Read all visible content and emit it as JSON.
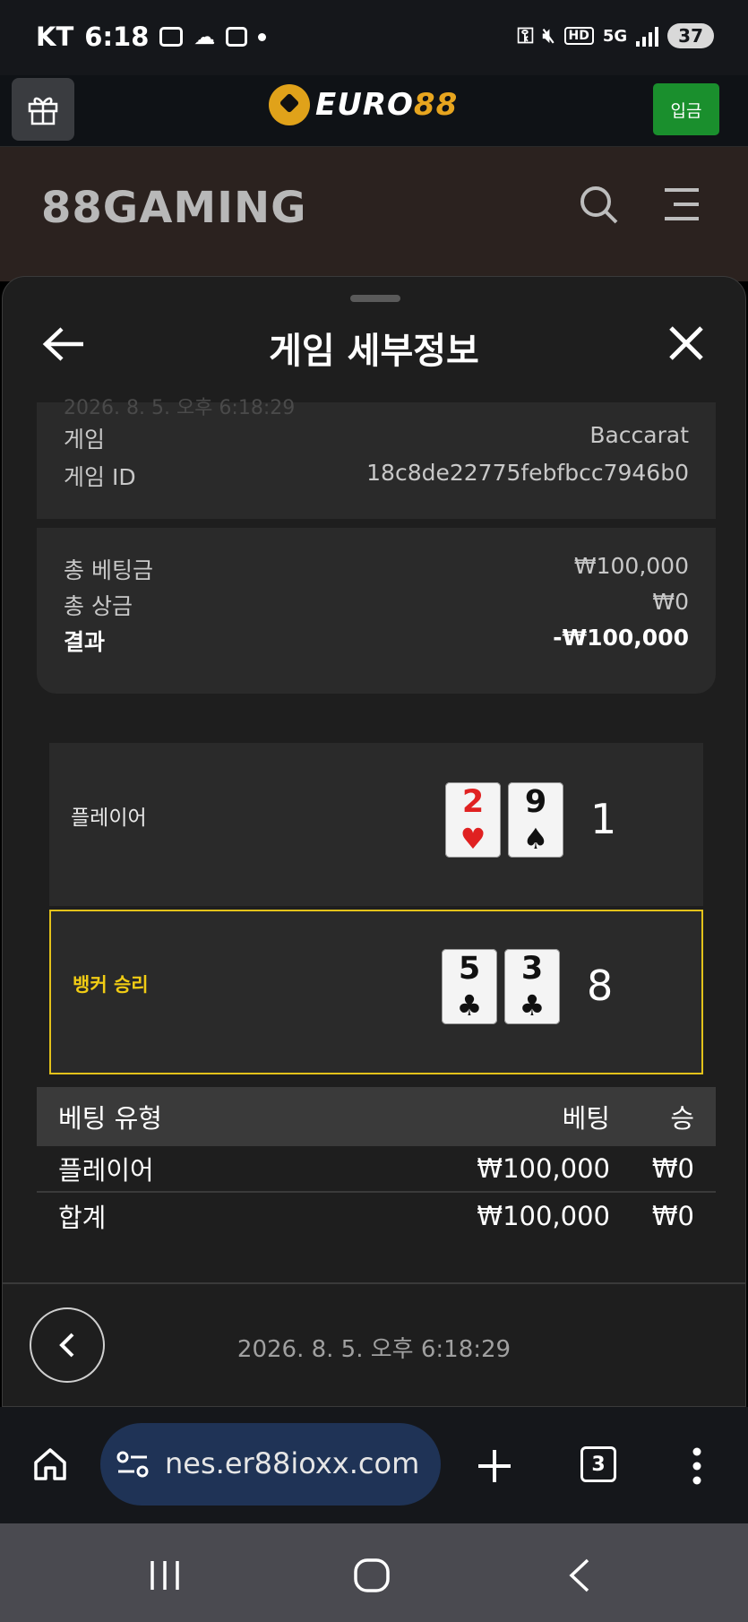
{
  "status_bar": {
    "carrier": "KT",
    "time": "6:18",
    "network": "5G",
    "hd": "HD",
    "battery": "37"
  },
  "site_header": {
    "logo_prefix": "EURO",
    "logo_suffix": "88",
    "deposit_label": "입금",
    "brand_color": "#e7a51f",
    "deposit_color": "#1a8f2d"
  },
  "gaming_header": {
    "logo": "88GAMING"
  },
  "sheet": {
    "title": "게임 세부정보",
    "cutoff_text": "2026. 8. 5. 오후 6:18:29",
    "game_label": "게임",
    "game_value": "Baccarat",
    "game_id_label": "게임 ID",
    "game_id_value": "18c8de22775febfbcc7946b0",
    "total_bet_label": "총 베팅금",
    "total_bet_value": "₩100,000",
    "total_prize_label": "총 상금",
    "total_prize_value": "₩0",
    "result_label": "결과",
    "result_value": "-₩100,000"
  },
  "hands": {
    "player": {
      "label": "플레이어",
      "cards": [
        {
          "rank": "2",
          "suit": "♥",
          "color": "red"
        },
        {
          "rank": "9",
          "suit": "♠",
          "color": "black"
        }
      ],
      "score": "1"
    },
    "banker": {
      "label": "뱅커 승리",
      "cards": [
        {
          "rank": "5",
          "suit": "♣",
          "color": "black"
        },
        {
          "rank": "3",
          "suit": "♣",
          "color": "black"
        }
      ],
      "score": "8",
      "highlight_color": "#e3c21a"
    }
  },
  "bet_table": {
    "headers": [
      "베팅 유형",
      "베팅",
      "승"
    ],
    "rows": [
      {
        "type": "플레이어",
        "bet": "₩100,000",
        "win": "₩0"
      }
    ],
    "total": {
      "type": "합계",
      "bet": "₩100,000",
      "win": "₩0"
    }
  },
  "footer": {
    "timestamp": "2026. 8. 5. 오후 6:18:29"
  },
  "browser": {
    "url": "nes.er88ioxx.com",
    "tab_count": "3"
  }
}
